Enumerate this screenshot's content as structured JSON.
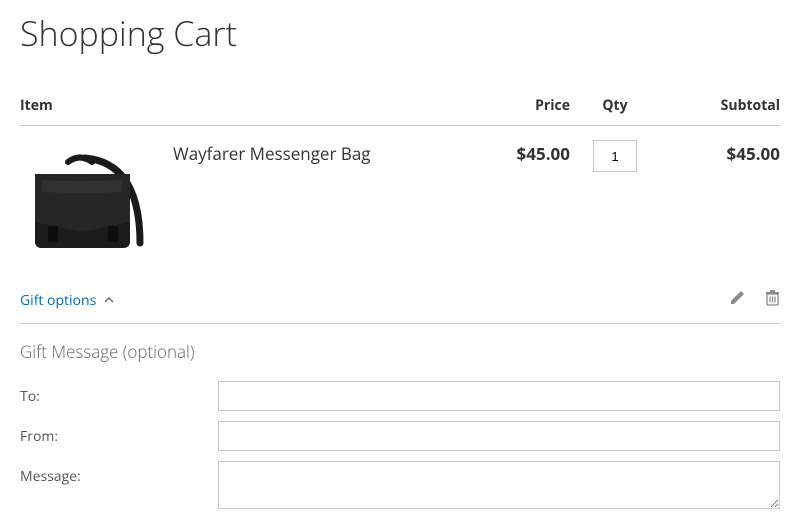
{
  "page": {
    "title": "Shopping Cart"
  },
  "table": {
    "headers": {
      "item": "Item",
      "price": "Price",
      "qty": "Qty",
      "subtotal": "Subtotal"
    },
    "row": {
      "name": "Wayfarer Messenger Bag",
      "price": "$45.00",
      "qty": "1",
      "subtotal": "$45.00"
    }
  },
  "gift": {
    "toggle": "Gift options",
    "heading": "Gift Message (optional)",
    "labels": {
      "to": "To:",
      "from": "From:",
      "message": "Message:"
    },
    "values": {
      "to": "",
      "from": "",
      "message": ""
    }
  },
  "icons": {
    "chevron": "˄",
    "edit": "edit-icon",
    "trash": "trash-icon"
  }
}
